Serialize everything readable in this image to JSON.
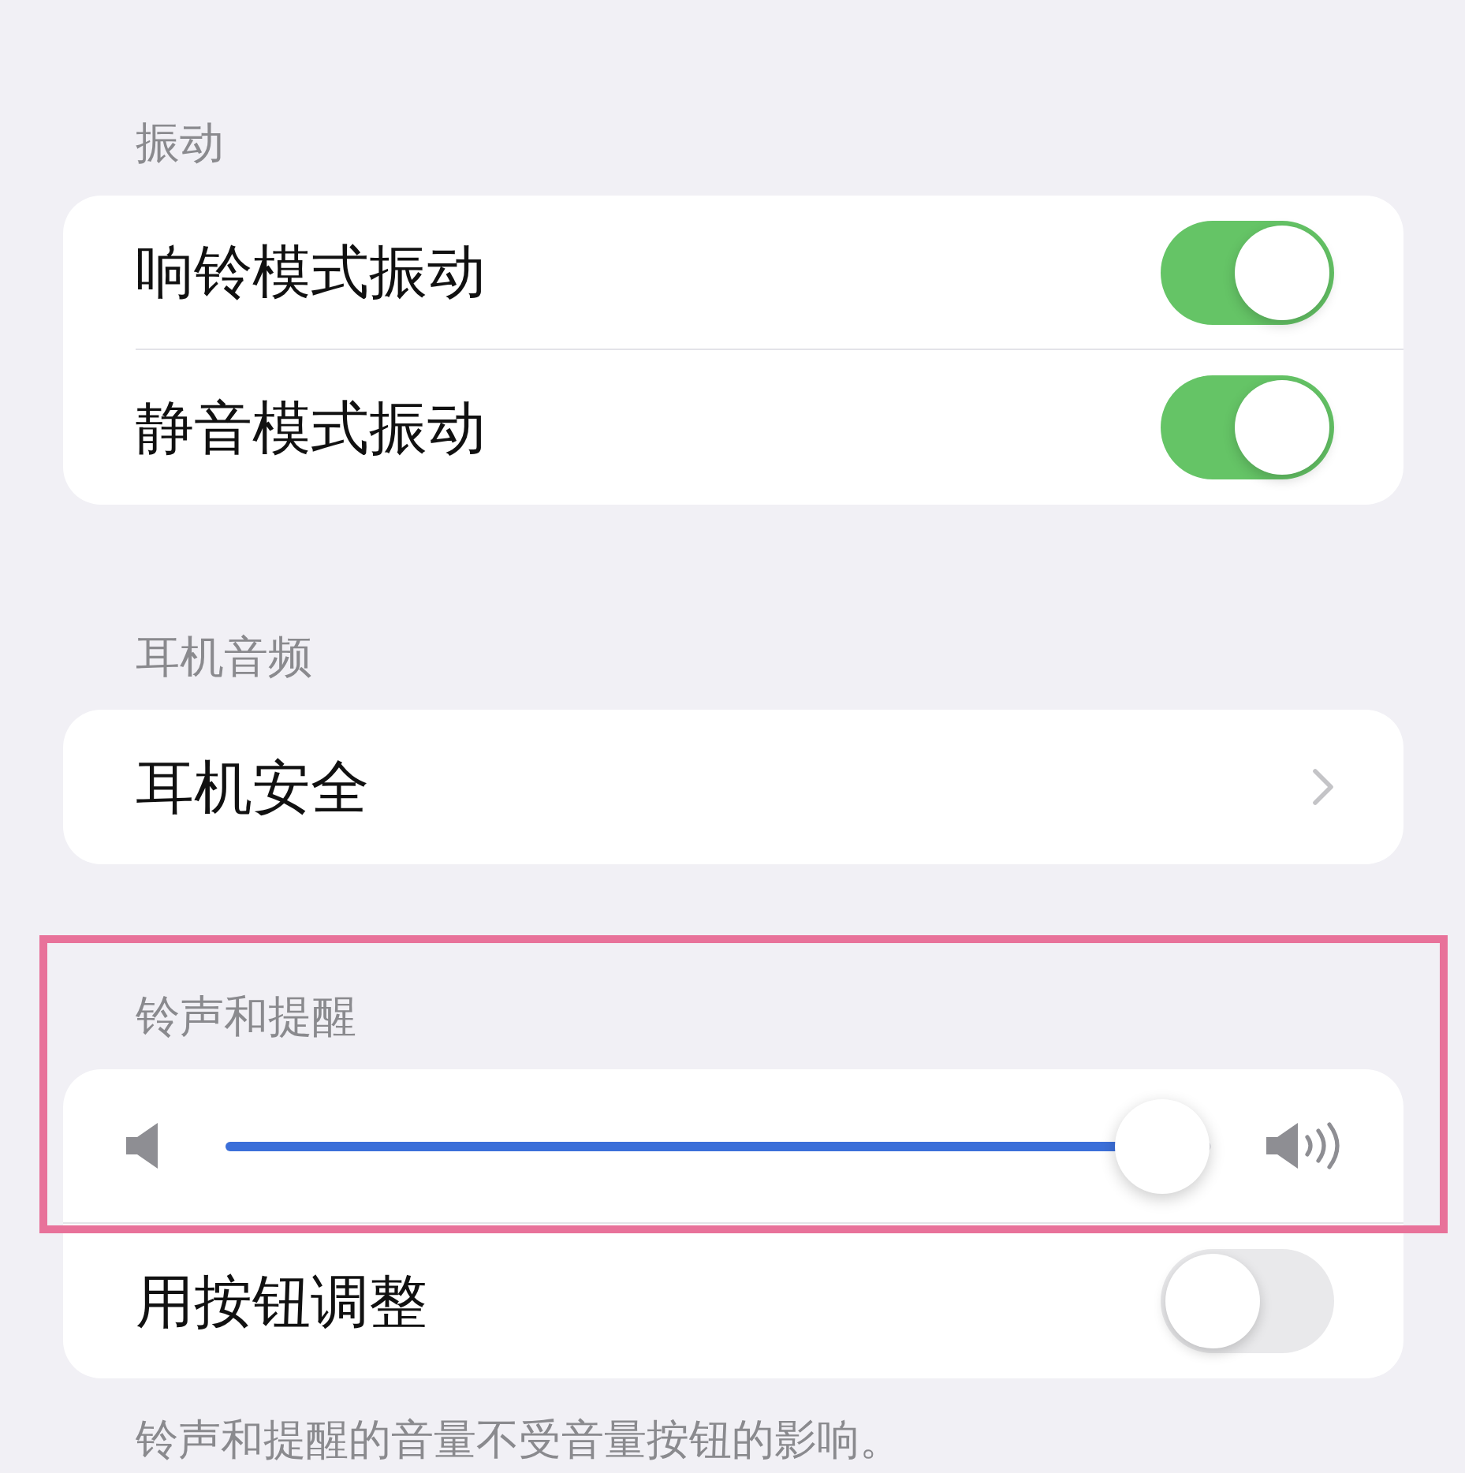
{
  "sections": [
    {
      "header": "振动",
      "highlighted": false,
      "rows": [
        {
          "kind": "toggle",
          "label": "响铃模式振动",
          "on": true
        },
        {
          "kind": "toggle",
          "label": "静音模式振动",
          "on": true
        }
      ]
    },
    {
      "header": "耳机音频",
      "highlighted": false,
      "rows": [
        {
          "kind": "link",
          "label": "耳机安全"
        }
      ]
    },
    {
      "header": "铃声和提醒",
      "highlighted": true,
      "rows": [
        {
          "kind": "slider",
          "level": 0.95
        },
        {
          "kind": "toggle",
          "label": "用按钮调整",
          "on": false
        }
      ],
      "footnote": "铃声和提醒的音量不受音量按钮的影响。"
    }
  ]
}
